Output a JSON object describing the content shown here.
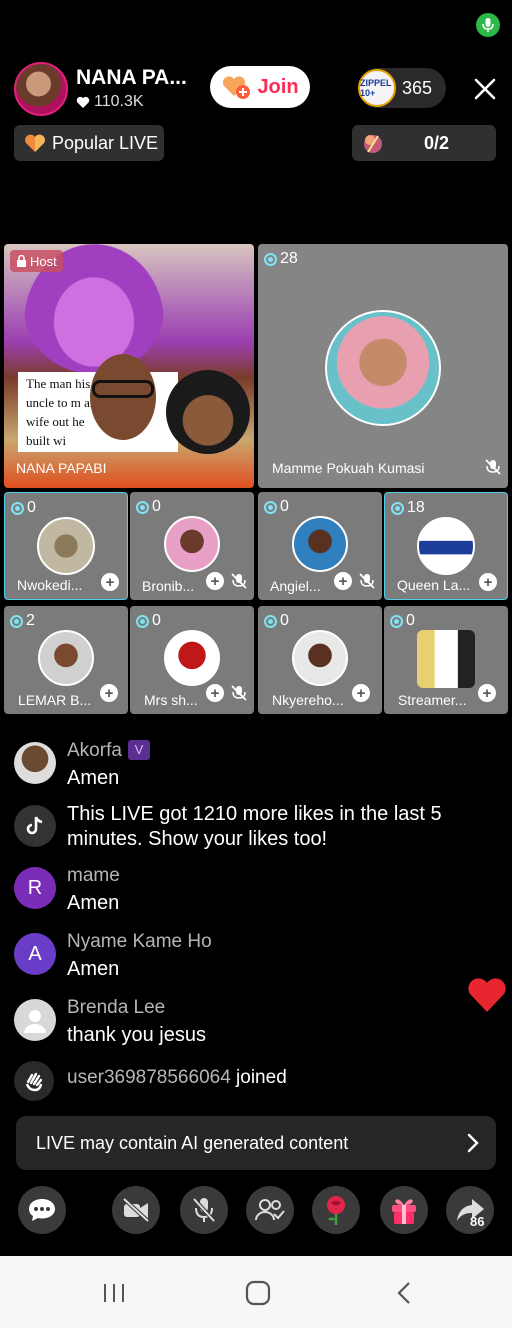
{
  "status": {
    "mic_icon": "mic-icon"
  },
  "header": {
    "host_name": "NANA PA...",
    "host_likes": "110.3K",
    "join_label": "Join",
    "viewer_badge_text": "ZIPPEL 10+",
    "viewer_count": "365",
    "popular_label": "Popular LIVE",
    "ranking_value": "0/2"
  },
  "host_tile": {
    "label": "Host",
    "name": "NANA PAPABI",
    "caption_lines": [
      "The man  his",
      "uncle to m  ana",
      "wife out    he",
      "built wi"
    ]
  },
  "featured_tile": {
    "count": "28",
    "name": "Mamme Pokuah Kumasi"
  },
  "guests": [
    {
      "count": "0",
      "name": "Nwokedi...",
      "muted": false,
      "highlight": true
    },
    {
      "count": "0",
      "name": "Bronib...",
      "muted": true,
      "highlight": false
    },
    {
      "count": "0",
      "name": "Angiel...",
      "muted": true,
      "highlight": false
    },
    {
      "count": "18",
      "name": "Queen La...",
      "muted": false,
      "highlight": true
    },
    {
      "count": "2",
      "name": "LEMAR B...",
      "muted": false,
      "highlight": false
    },
    {
      "count": "0",
      "name": "Mrs sh...",
      "muted": true,
      "highlight": false
    },
    {
      "count": "0",
      "name": "Nkyereho...",
      "muted": false,
      "highlight": false
    },
    {
      "count": "0",
      "name": "Streamer...",
      "muted": false,
      "highlight": false
    }
  ],
  "chat": [
    {
      "user": "Akorfa",
      "badge": "V",
      "text": "Amen"
    },
    {
      "system_line1": "This LIVE got 1210 more likes in the last 5",
      "system_line2": "minutes. Show your likes too!"
    },
    {
      "initial": "R",
      "user": "mame",
      "text": "Amen"
    },
    {
      "initial": "A",
      "user": "Nyame Kame Ho",
      "text": "Amen"
    },
    {
      "user": "Brenda Lee",
      "text": "thank you jesus"
    },
    {
      "user": "user369878566064",
      "text": "joined"
    }
  ],
  "ai_notice": "LIVE may contain AI generated content",
  "bottom_bar": {
    "share_count": "86"
  },
  "colors": {
    "accent": "#fe2c55",
    "highlight": "#4fd0e8",
    "mic_green": "#2db84a"
  }
}
